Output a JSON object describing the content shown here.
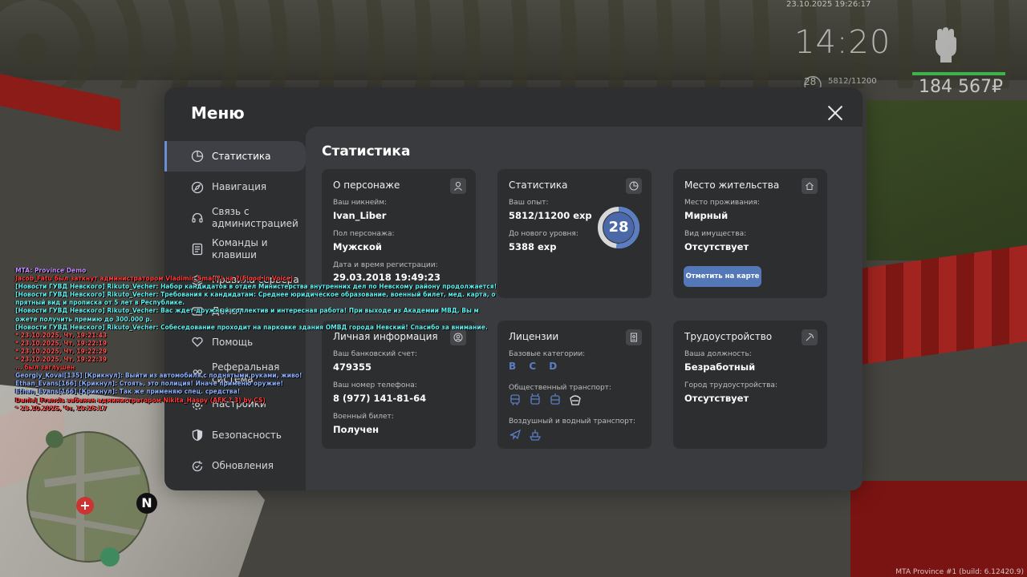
{
  "hud": {
    "datetime": "23.10.2025 19:26:17",
    "clock": "14:20",
    "level": "28",
    "exp": "5812/11200",
    "money": "184 567₽",
    "build": "MTA Province #1 (build: 6.12420.9)"
  },
  "minimap": {
    "north": "N"
  },
  "menu": {
    "title": "Меню",
    "close_icon": "close-icon",
    "sidebar": [
      {
        "label": "Статистика",
        "icon": "pie-chart-icon",
        "active": true
      },
      {
        "label": "Навигация",
        "icon": "compass-icon"
      },
      {
        "label": "Связь с администрацией",
        "icon": "headset-icon"
      },
      {
        "label": "Команды и клавиши",
        "icon": "list-icon"
      },
      {
        "label": "Правила сервера",
        "icon": "rules-icon"
      },
      {
        "label": "Донат",
        "icon": "donate-icon"
      },
      {
        "label": "Помощь",
        "icon": "heart-hand-icon"
      },
      {
        "label": "Реферальная система",
        "icon": "referral-icon"
      },
      {
        "label": "Настройки",
        "icon": "gear-icon"
      },
      {
        "label": "Безопасность",
        "icon": "shield-icon"
      },
      {
        "label": "Обновления",
        "icon": "refresh-icon"
      }
    ],
    "content_title": "Статистика",
    "cards": {
      "character": {
        "title": "О персонаже",
        "nickname_label": "Ваш никнейм:",
        "nickname": "Ivan_Liber",
        "gender_label": "Пол персонажа:",
        "gender": "Мужской",
        "reg_label": "Дата и время регистрации:",
        "reg": "29.03.2018 19:49:23"
      },
      "stats": {
        "title": "Статистика",
        "exp_label": "Ваш опыт:",
        "exp": "5812/11200 exp",
        "next_label": "До нового уровня:",
        "next": "5388 exp",
        "level": "28",
        "level_progress": 0.519
      },
      "residence": {
        "title": "Место жительства",
        "place_label": "Место проживания:",
        "place": "Мирный",
        "property_label": "Вид имущества:",
        "property": "Отсутствует",
        "button": "Отметить на карте"
      },
      "personal": {
        "title": "Личная информация",
        "bank_label": "Ваш банковский счет:",
        "bank": "479355",
        "phone_label": "Ваш номер телефона:",
        "phone": "8 (977) 141-81-64",
        "military_label": "Военный билет:",
        "military": "Получен"
      },
      "licenses": {
        "title": "Лицензии",
        "base_label": "Базовые категории:",
        "base": "B C D",
        "public_label": "Общественный транспорт:",
        "air_label": "Воздушный и водный транспорт:"
      },
      "job": {
        "title": "Трудоустройство",
        "position_label": "Ваша должность:",
        "position": "Безработный",
        "city_label": "Город трудоустройства:",
        "city": "Отсутствует"
      }
    }
  },
  "chat": [
    {
      "text": "MTA: Province Demo",
      "color": "#c48cff"
    },
    {
      "text": "Jacob_Fatu был заткнут администратором Vladimir_Smal(?) на ?(Flood in Voice)",
      "color": "#ff3a3a"
    },
    {
      "text": "[Новости ГУВД Невского] Rikuto_Vecher: Набор кандидатов в отдел Министерства внутренних дел по Невскому району продолжается!",
      "color": "#5ef0f0"
    },
    {
      "text": "[Новости ГУВД Невского] Rikuto_Vecher: Требования к кандидатам: Среднее юридическое образование, военный билет, мед. карта, о",
      "color": "#5ef0f0"
    },
    {
      "text": "прятный вид и прописка от 5 лет в Республике.",
      "color": "#5ef0f0"
    },
    {
      "text": "[Новости ГУВД Невского] Rikuto_Vecher: Вас ждет дружный коллектив и интересная работа! При выходе из Академии МВД, Вы м",
      "color": "#5ef0f0"
    },
    {
      "text": "ожете получить премию до 300.000 р.",
      "color": "#5ef0f0"
    },
    {
      "text": "[Новости ГУВД Невского] Rikuto_Vecher: Собеседование проходит на парковке здания ОМВД города Невский! Спасибо за внимание.",
      "color": "#5ef0f0"
    },
    {
      "text": "* 23.10.2025, Чт, 19:21:43",
      "color": "#ff4d4d"
    },
    {
      "text": "* 23.10.2025, Чт, 19:22:19",
      "color": "#ff4d4d"
    },
    {
      "text": "* 23.10.2025, Чт, 19:22:29",
      "color": "#ff4d4d"
    },
    {
      "text": "* 23.10.2025, Чт, 19:22:39",
      "color": "#ff4d4d"
    },
    {
      "text": "... был заглушен",
      "color": "#ff3a3a"
    },
    {
      "text": "Georgiy_Koval[135] [Крикнул]: Выйти из автомобиля с поднятыми руками, живо!",
      "color": "#8ab0ff"
    },
    {
      "text": "Ethan_Evans[166] [Крикнул]: Стоять, это полиция! Иначе применю оружие!",
      "color": "#8ab0ff"
    },
    {
      "text": "Ethan_Evans[166] [Крикнул]: Так же применяю спец. средства!",
      "color": "#8ab0ff"
    },
    {
      "text": "Daniel_Francis забанен администратором Nikita_Haspy (AFK ? 3) by CS)",
      "color": "#ff3a3a"
    },
    {
      "text": "* 23.10.2025, Чт, 19:26:17",
      "color": "#ff4d4d"
    }
  ]
}
